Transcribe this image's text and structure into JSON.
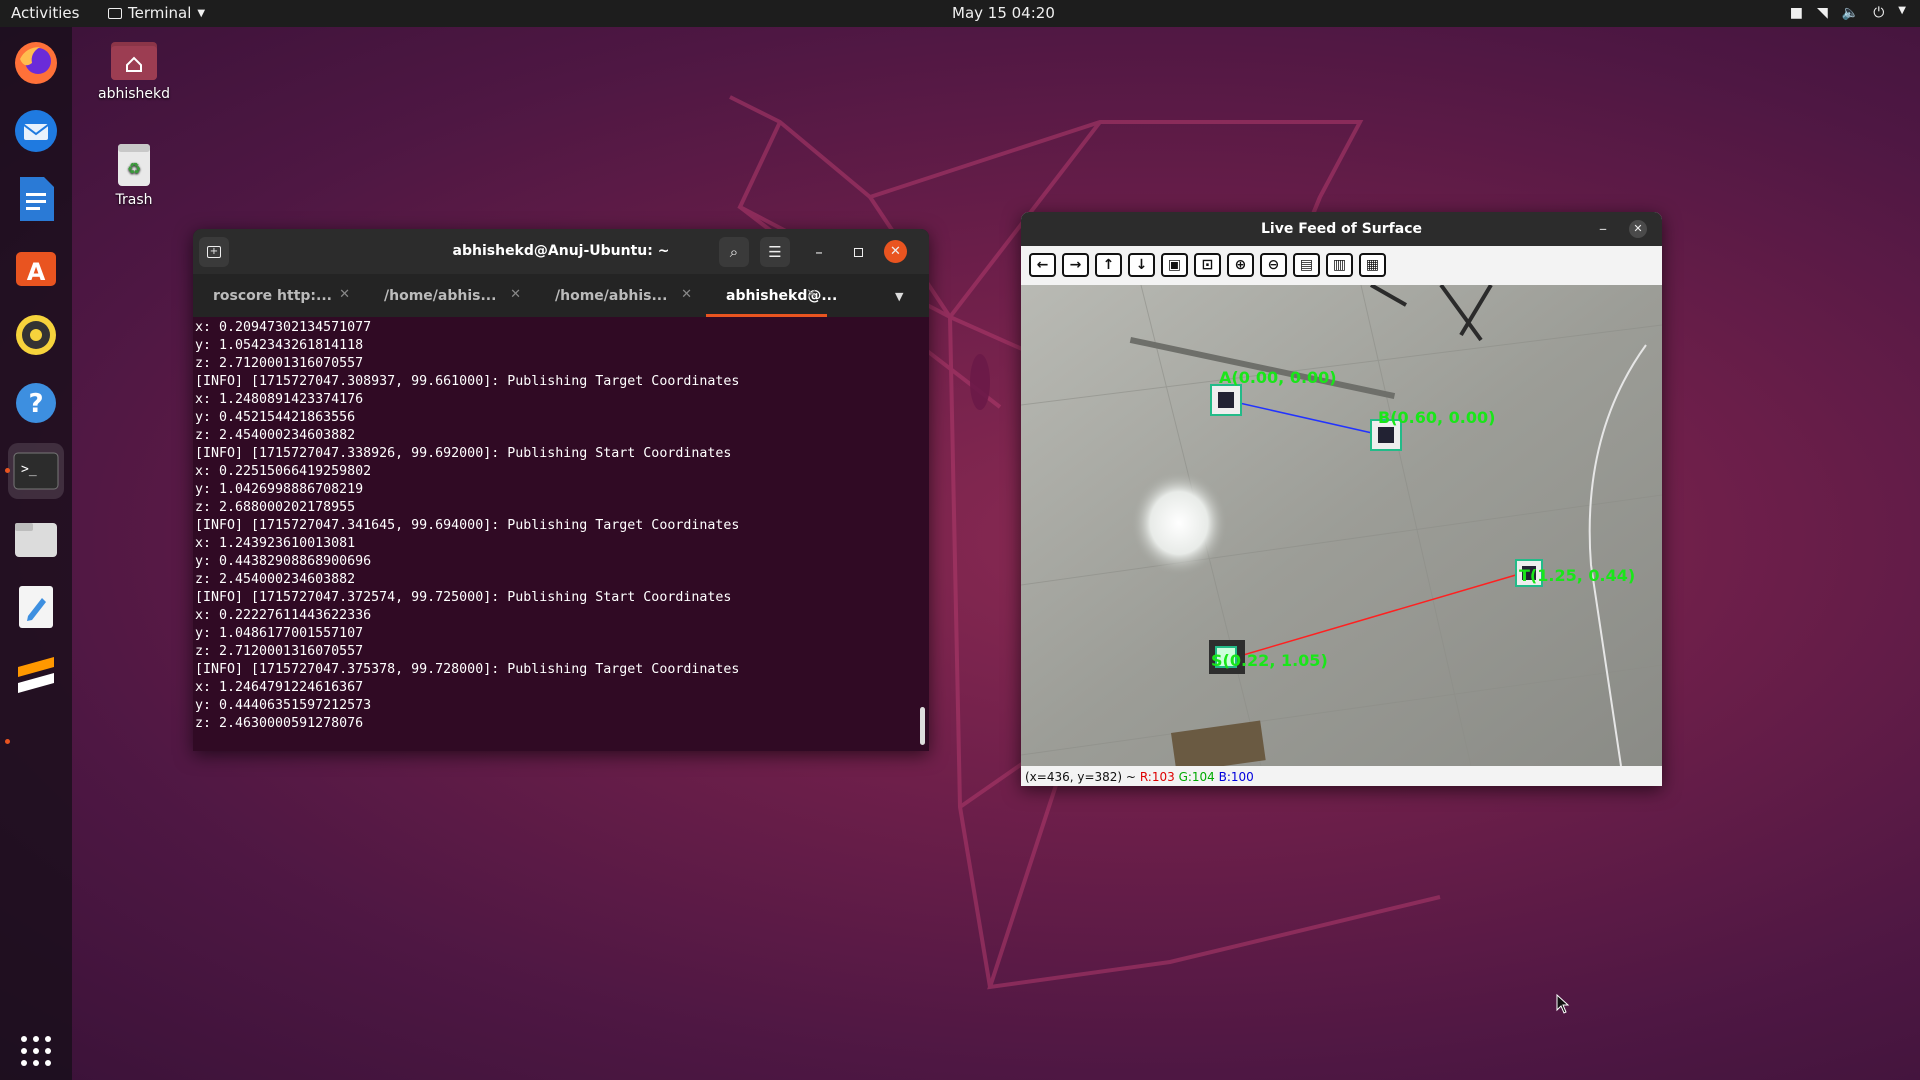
{
  "topbar": {
    "activities": "Activities",
    "app_name": "Terminal",
    "clock": "May 15  04:20"
  },
  "desktop": {
    "home_label": "abhishekd",
    "trash_label": "Trash"
  },
  "dock": {
    "items": [
      "firefox-icon",
      "thunderbird-icon",
      "writer-icon",
      "software-icon",
      "rhythmbox-icon",
      "help-icon",
      "terminal-icon",
      "files-icon",
      "text-editor-icon",
      "sublime-icon"
    ],
    "accent": "#e95420"
  },
  "terminal": {
    "title": "abhishekd@Anuj-Ubuntu: ~",
    "tabs": [
      {
        "label": "roscore http:..."
      },
      {
        "label": "/home/abhis..."
      },
      {
        "label": "/home/abhis..."
      },
      {
        "label": "abhishekd@..."
      }
    ],
    "lines": [
      "x: 0.20947302134571077",
      "y: 1.0542343261814118",
      "z: 2.7120001316070557",
      "[INFO] [1715727047.308937, 99.661000]: Publishing Target Coordinates",
      "x: 1.2480891423374176",
      "y: 0.452154421863556",
      "z: 2.454000234603882",
      "[INFO] [1715727047.338926, 99.692000]: Publishing Start Coordinates",
      "x: 0.22515066419259802",
      "y: 1.0426998886708219",
      "z: 2.688000202178955",
      "[INFO] [1715727047.341645, 99.694000]: Publishing Target Coordinates",
      "x: 1.243923610013081",
      "y: 0.44382908868900696",
      "z: 2.454000234603882",
      "[INFO] [1715727047.372574, 99.725000]: Publishing Start Coordinates",
      "x: 0.22227611443622336",
      "y: 1.0486177001557107",
      "z: 2.7120001316070557",
      "[INFO] [1715727047.375378, 99.728000]: Publishing Target Coordinates",
      "x: 1.2464791224616367",
      "y: 0.44406351597212573",
      "z: 2.4630000591278076"
    ]
  },
  "feed": {
    "title": "Live Feed of Surface",
    "markers": {
      "a": "A(0.00, 0.00)",
      "b": "B(0.60, 0.00)",
      "t": "T(1.25, 0.44)",
      "s": "S(0.22, 1.05)"
    },
    "status": {
      "pos": "(x=436, y=382) ~",
      "r": "R:103",
      "g": "G:104",
      "b": "B:100"
    }
  }
}
